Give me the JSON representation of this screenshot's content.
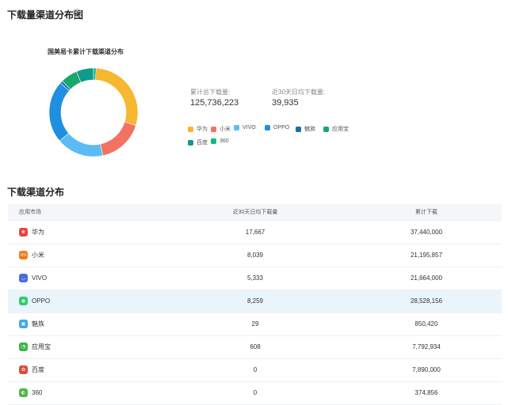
{
  "header": {
    "title": "下载量渠道分布图",
    "help_icon": "?"
  },
  "chart_panel": {
    "title": "国美易卡累计下载渠道分布",
    "stats": [
      {
        "label": "累计总下载量:",
        "value": "125,736,223"
      },
      {
        "label": "近30天日均下载量:",
        "value": "39,935"
      }
    ]
  },
  "chart_data": {
    "type": "pie",
    "title": "国美易卡累计下载渠道分布",
    "categories": [
      "华为",
      "小米",
      "VIVO",
      "OPPO",
      "魅族",
      "应用宝",
      "百度",
      "360"
    ],
    "values": [
      37440000,
      21195857,
      21664000,
      28528156,
      850420,
      7792934,
      7890000,
      374856
    ],
    "colors": [
      "#f7b731",
      "#f27362",
      "#5bbcf5",
      "#1e8fe1",
      "#1a6fa8",
      "#19a86b",
      "#0f9a8a",
      "#12b886"
    ],
    "donut": true,
    "legend_placement": "bottom"
  },
  "table_section": {
    "title": "下载渠道分布",
    "columns": [
      "应用市场",
      "近30天日均下载量",
      "累计下载"
    ],
    "rows": [
      {
        "name": "华为",
        "daily": "17,667",
        "total": "37,440,000",
        "icon": "huawei-icon",
        "icon_color": "#e8453c",
        "highlight": false
      },
      {
        "name": "小米",
        "daily": "8,039",
        "total": "21,195,857",
        "icon": "xiaomi-icon",
        "icon_color": "#f27a1a",
        "highlight": false
      },
      {
        "name": "VIVO",
        "daily": "5,333",
        "total": "21,664,000",
        "icon": "vivo-icon",
        "icon_color": "#4a6ee0",
        "highlight": false
      },
      {
        "name": "OPPO",
        "daily": "8,259",
        "total": "28,528,156",
        "icon": "oppo-icon",
        "icon_color": "#2ecc71",
        "highlight": true
      },
      {
        "name": "魅族",
        "daily": "29",
        "total": "850,420",
        "icon": "meizu-icon",
        "icon_color": "#3aa8f0",
        "highlight": false
      },
      {
        "name": "应用宝",
        "daily": "608",
        "total": "7,792,934",
        "icon": "yingyongbao-icon",
        "icon_color": "#3fb44a",
        "highlight": false
      },
      {
        "name": "百度",
        "daily": "0",
        "total": "7,890,000",
        "icon": "baidu-icon",
        "icon_color": "#e04a3a",
        "highlight": false
      },
      {
        "name": "360",
        "daily": "0",
        "total": "374,856",
        "icon": "360-icon",
        "icon_color": "#4cb84a",
        "highlight": false
      }
    ]
  }
}
